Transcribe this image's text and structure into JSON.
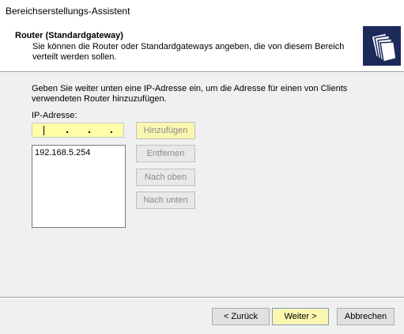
{
  "window": {
    "title": "Bereichserstellungs-Assistent"
  },
  "header": {
    "title": "Router (Standardgateway)",
    "subtitle": "Sie können die Router oder Standardgateways angeben, die von diesem Bereich verteilt werden sollen.",
    "icon": "folders-icon"
  },
  "body": {
    "intro": "Geben Sie weiter unten eine IP-Adresse ein, um die Adresse für einen von Clients verwendeten Router hinzuzufügen.",
    "ip_label": "IP-Adresse:",
    "ip_value": "",
    "router_list": [
      "192.168.5.254"
    ]
  },
  "buttons": {
    "add": "Hinzufügen",
    "remove": "Entfernen",
    "up": "Nach oben",
    "down": "Nach unten"
  },
  "nav": {
    "back": "< Zurück",
    "next": "Weiter >",
    "cancel": "Abbrechen"
  },
  "colors": {
    "highlight": "#ffffa8",
    "icon_bg": "#1c2a5a"
  }
}
